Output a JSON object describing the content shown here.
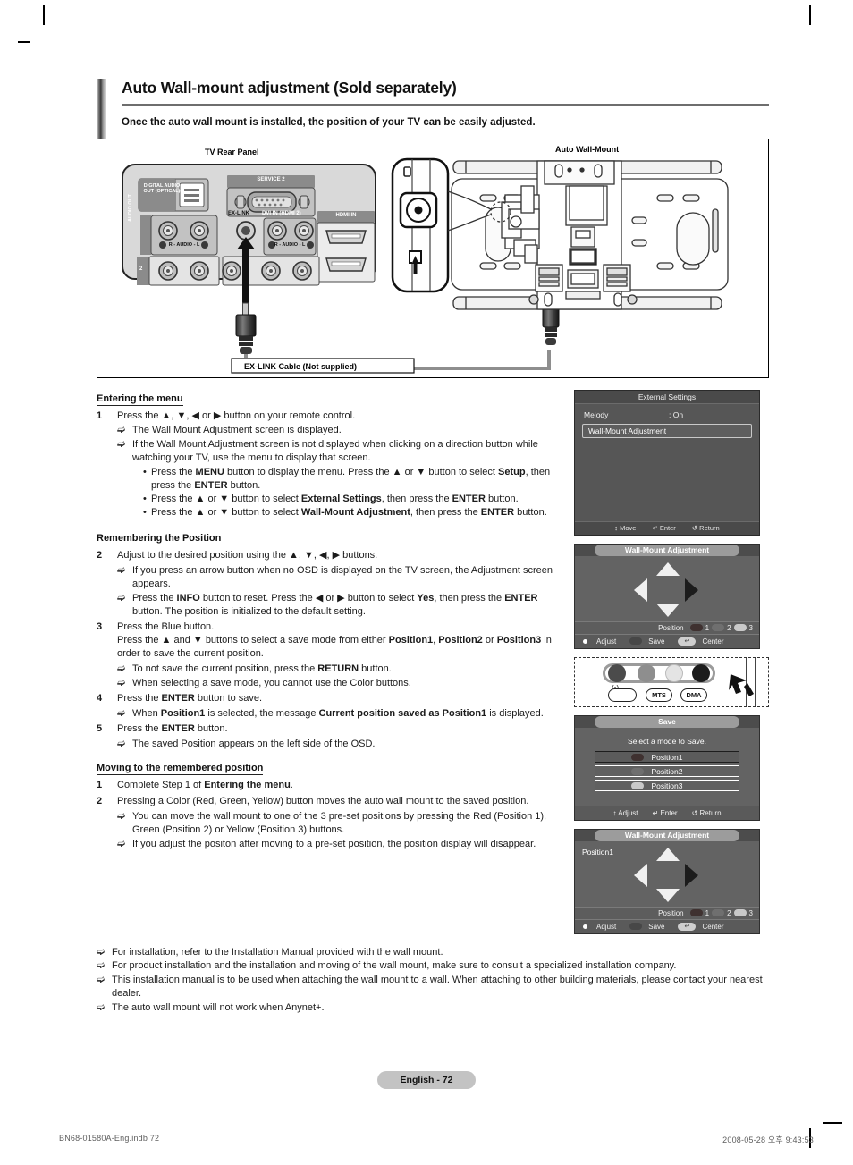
{
  "header": {
    "title": "Auto Wall-mount adjustment (Sold separately)",
    "subtitle": "Once the auto wall mount is installed, the position of your TV can be easily adjusted."
  },
  "figure": {
    "label_left": "TV Rear Panel",
    "label_right": "Auto Wall-Mount",
    "cable_caption": "EX-LINK Cable (Not supplied)",
    "ports": {
      "digital_audio_out": "DIGITAL AUDIO OUT (OPTICAL)",
      "service2": "SERVICE 2",
      "hdmi_in": "HDMI IN",
      "ex_link": "EX-LINK",
      "dvi_in": "DVI IN (HDMI 2)",
      "audio_out": "AUDIO OUT",
      "audio_rl": "R - AUDIO - L",
      "component_num": "2"
    }
  },
  "sections": {
    "entering": {
      "heading": "Entering the menu",
      "step1": {
        "num": "1",
        "text_pre": "Press the ",
        "text_arrows": "▲, ▼, ◀ or ▶",
        "text_post": " button on your remote control."
      },
      "notes": [
        "The Wall Mount Adjustment screen is displayed.",
        "If the Wall Mount Adjustment screen is not displayed when clicking on a direction button while watching your TV, use the menu to display that screen."
      ],
      "bullets": [
        "Press the MENU button to display the menu. Press the ▲ or ▼ button to select Setup, then press the ENTER button.",
        "Press the ▲ or ▼ button to select External Settings, then press the ENTER button.",
        "Press the ▲ or ▼ button to select Wall-Mount Adjustment, then press the ENTER button."
      ]
    },
    "remembering": {
      "heading": "Remembering the Position",
      "step2": {
        "num": "2",
        "text": "Adjust to the desired position using the ▲, ▼, ◀, ▶ buttons."
      },
      "step2_notes": [
        "If you press an arrow button when no OSD is displayed on the TV screen, the Adjustment screen appears.",
        "Press the INFO button to reset. Press the ◀ or ▶ button to select Yes, then press the ENTER button. The position is initialized to the default setting."
      ],
      "step3": {
        "num": "3",
        "line1": "Press the Blue button.",
        "line2": "Press the ▲ and ▼ buttons to select a save mode from either Position1, Position2 or Position3 in order to save the current position."
      },
      "step3_notes": [
        "To not save the current position, press the RETURN button.",
        "When selecting a save mode, you cannot use the Color buttons."
      ],
      "step4": {
        "num": "4",
        "text": "Press the ENTER button to save."
      },
      "step4_notes": [
        "When Position1 is selected, the message Current position saved as Position1 is displayed."
      ],
      "step5": {
        "num": "5",
        "text": "Press the ENTER button."
      },
      "step5_notes": [
        "The saved Position appears on the left side of the OSD."
      ]
    },
    "moving": {
      "heading": "Moving to the remembered position",
      "step1": {
        "num": "1",
        "text": "Complete Step 1 of Entering the menu."
      },
      "step2": {
        "num": "2",
        "text": "Pressing a Color (Red, Green, Yellow) button moves the auto wall mount to the saved position."
      },
      "step2_notes": [
        "You can move the wall mount to one of the 3 pre-set positions by pressing the Red (Position 1), Green (Position 2) or Yellow (Position 3) buttons.",
        "If you adjust the positon after moving to a pre-set position, the position display will disappear."
      ],
      "final_notes": [
        "For installation, refer to the Installation Manual provided with the wall mount.",
        "For product installation and the installation and moving of the wall mount, make sure to consult a specialized installation company.",
        "This installation manual is to be used when attaching the wall mount to a wall. When attaching to other building materials, please contact your nearest dealer.",
        "The auto wall mount will not work when Anynet+."
      ]
    }
  },
  "osd": {
    "external_settings": {
      "title": "External Settings",
      "melody_key": "Melody",
      "melody_value": ": On",
      "selected_item": "Wall-Mount Adjustment",
      "footer": {
        "move": "Move",
        "enter": "Enter",
        "return": "Return"
      }
    },
    "wall_mount_1": {
      "title": "Wall-Mount Adjustment",
      "position_label": "Position",
      "position_numbers": [
        "1",
        "2",
        "3"
      ],
      "adjust": "Adjust",
      "save": "Save",
      "center": "Center",
      "center_chip_glyph": "↩",
      "saved_position": ""
    },
    "save_dialog": {
      "title": "Save",
      "prompt": "Select a mode to Save.",
      "options": [
        "Position1",
        "Position2",
        "Position3"
      ],
      "footer": {
        "adjust": "Adjust",
        "enter": "Enter",
        "return": "Return"
      }
    },
    "wall_mount_2": {
      "title": "Wall-Mount Adjustment",
      "position_label": "Position",
      "position_numbers": [
        "1",
        "2",
        "3"
      ],
      "adjust": "Adjust",
      "save": "Save",
      "center": "Center",
      "center_chip_glyph": "↩",
      "saved_position": "Position1"
    }
  },
  "remote": {
    "color_buttons": [
      "red",
      "green",
      "yellow",
      "blue"
    ],
    "labels": [
      "",
      "MTS",
      "DMA"
    ]
  },
  "footer": {
    "page_label": "English - 72",
    "run_left": "BN68-01580A-Eng.indb   72",
    "run_right": "2008-05-28   오후 9:43:53"
  },
  "colors": {
    "osd_bg": "#636363",
    "osd_bar": "#4c4c4c",
    "page_pill": "#c3c3c3"
  }
}
